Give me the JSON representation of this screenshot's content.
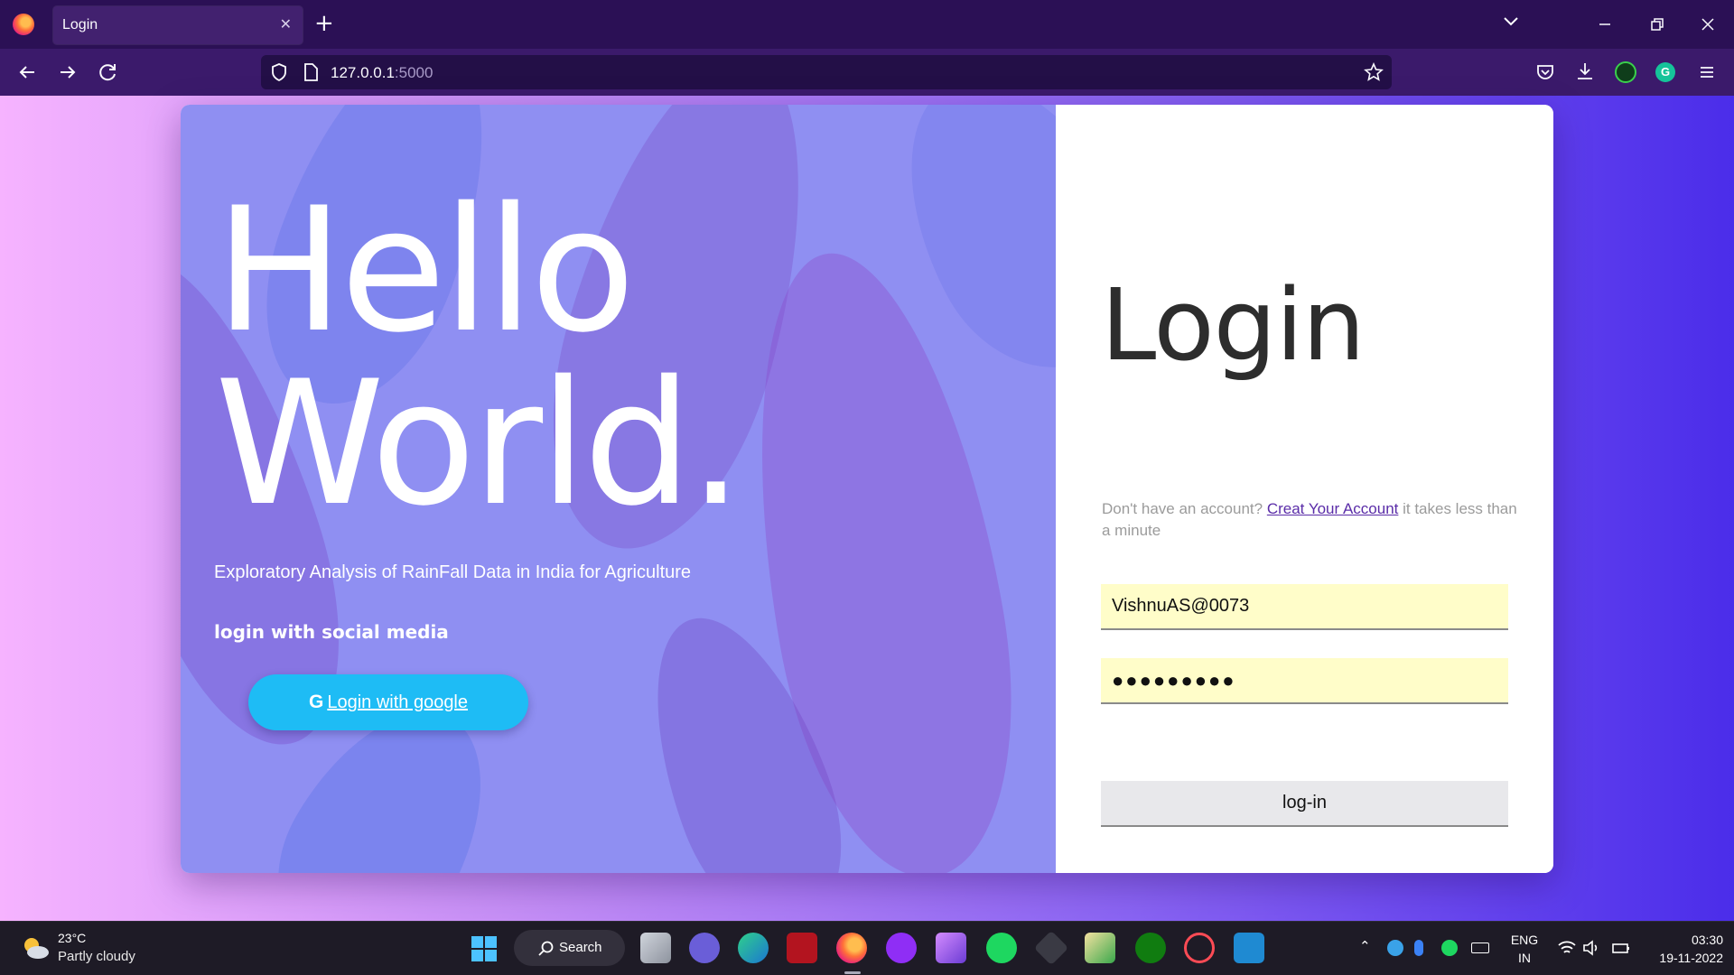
{
  "browser": {
    "tab_title": "Login",
    "url_host": "127.0.0.1",
    "url_port": ":5000"
  },
  "hero": {
    "line1": "Hello",
    "line2": "World.",
    "subtitle": "Exploratory Analysis of RainFall Data in India for Agriculture",
    "social_label": "login with social media",
    "google_glyph": "G",
    "google_button": " Login with google"
  },
  "login": {
    "title": "Login",
    "signup_prefix": "Don't have an account? ",
    "signup_link": "Creat Your Account",
    "signup_suffix": " it takes less than a minute",
    "username_value": "VishnuAS@0073",
    "password_masked": "●●●●●●●●●",
    "submit_label": "log-in"
  },
  "taskbar": {
    "weather_temp": "23°C",
    "weather_desc": "Partly cloudy",
    "search_label": "Search",
    "lang_line1": "ENG",
    "lang_line2": "IN",
    "time": "03:30",
    "date": "19-11-2022"
  },
  "colors": {
    "tabbar": "#2b1055",
    "navbar": "#3b1a6b",
    "hero_panel": "#8f8ff2",
    "google_button": "#1ebcf5",
    "input_bg": "#fffdc9",
    "link": "#5a2ca8"
  }
}
